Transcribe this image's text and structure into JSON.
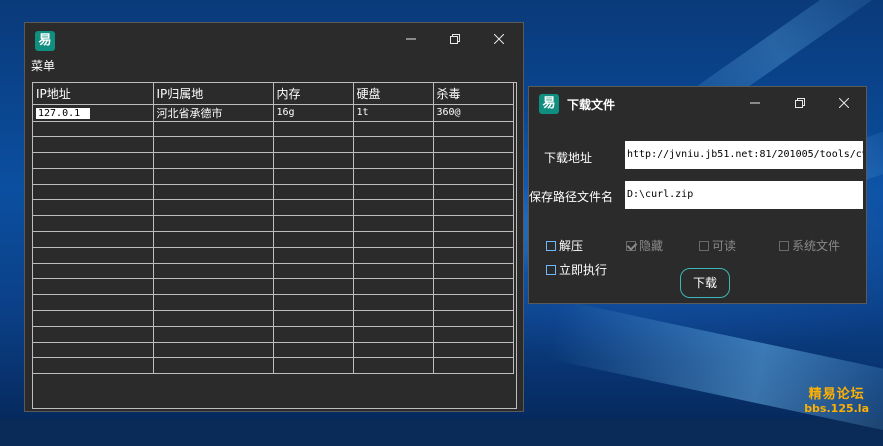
{
  "main_window": {
    "app_icon": "易",
    "menu_label": "菜单",
    "columns": [
      "IP地址",
      "IP归属地",
      "内存",
      "硬盘",
      "杀毒"
    ],
    "rows": [
      [
        "127.0.1",
        "河北省承德市",
        "16g",
        "1t",
        "360@"
      ]
    ],
    "empty_rows": 16
  },
  "download_window": {
    "app_icon": "易",
    "title": "下载文件",
    "url_label": "下载地址",
    "url_value": "http://jvniu.jb51.net:81/201005/tools/cv",
    "path_label": "保存路径文件名",
    "path_value": "D:\\curl.zip",
    "checkboxes": {
      "unzip": {
        "label": "解压",
        "checked": false,
        "enabled": true
      },
      "hidden": {
        "label": "隐藏",
        "checked": true,
        "enabled": false
      },
      "readable": {
        "label": "可读",
        "checked": false,
        "enabled": false
      },
      "system_file": {
        "label": "系统文件",
        "checked": false,
        "enabled": false
      },
      "run_now": {
        "label": "立即执行",
        "checked": false,
        "enabled": true
      }
    },
    "download_button": "下载"
  },
  "watermark": {
    "line1": "精易论坛",
    "line2": "bbs.125.la"
  },
  "colors": {
    "window_bg": "#2b2b2b",
    "icon_bg": "#0f8f7f",
    "button_border": "#3cb6b6",
    "watermark": "#ffb000"
  }
}
